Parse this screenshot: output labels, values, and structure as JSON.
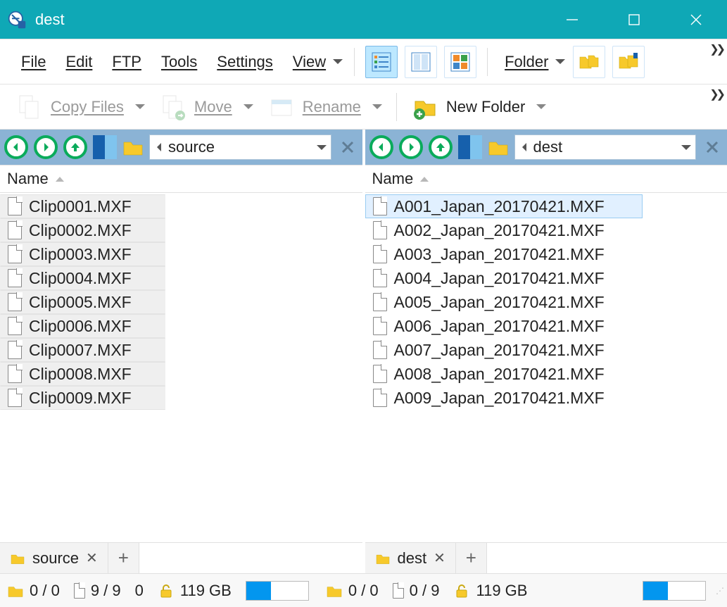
{
  "titlebar": {
    "title": "dest"
  },
  "menu": {
    "file": "File",
    "edit": "Edit",
    "ftp": "FTP",
    "tools": "Tools",
    "settings": "Settings",
    "view": "View",
    "folder": "Folder"
  },
  "actions": {
    "copy": "Copy Files",
    "move": "Move",
    "rename": "Rename",
    "newFolder": "New Folder"
  },
  "left": {
    "path": "source",
    "column": "Name",
    "files": [
      "Clip0001.MXF",
      "Clip0002.MXF",
      "Clip0003.MXF",
      "Clip0004.MXF",
      "Clip0005.MXF",
      "Clip0006.MXF",
      "Clip0007.MXF",
      "Clip0008.MXF",
      "Clip0009.MXF"
    ],
    "tab": "source",
    "status": {
      "foldersSel": "0 / 0",
      "filesSel": "9 / 9",
      "extra": "0",
      "disk": "119 GB",
      "diskUsedPct": 40
    }
  },
  "right": {
    "path": "dest",
    "column": "Name",
    "files": [
      "A001_Japan_20170421.MXF",
      "A002_Japan_20170421.MXF",
      "A003_Japan_20170421.MXF",
      "A004_Japan_20170421.MXF",
      "A005_Japan_20170421.MXF",
      "A006_Japan_20170421.MXF",
      "A007_Japan_20170421.MXF",
      "A008_Japan_20170421.MXF",
      "A009_Japan_20170421.MXF"
    ],
    "tab": "dest",
    "status": {
      "foldersSel": "0 / 0",
      "filesSel": "0 / 9",
      "extra": "",
      "disk": "119 GB",
      "diskUsedPct": 40
    }
  }
}
